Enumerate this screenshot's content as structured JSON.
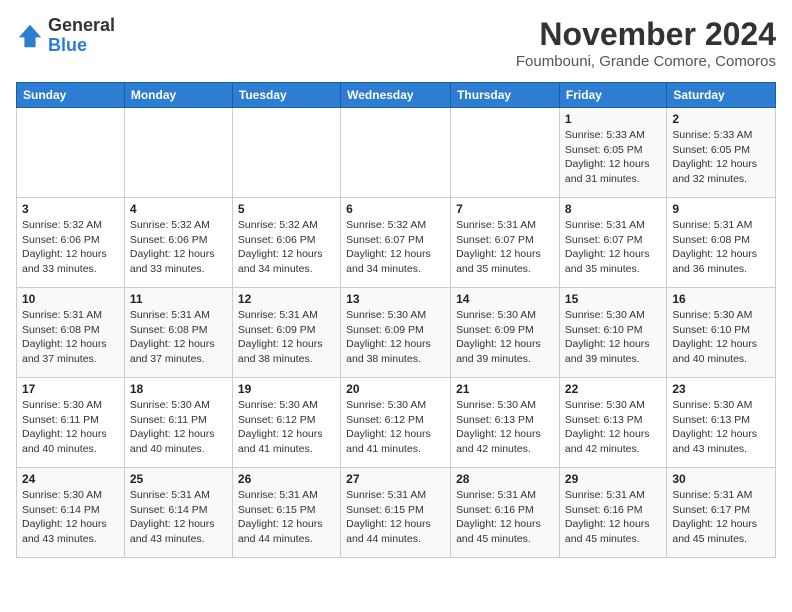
{
  "logo": {
    "general": "General",
    "blue": "Blue"
  },
  "title": "November 2024",
  "subtitle": "Foumbouni, Grande Comore, Comoros",
  "headers": [
    "Sunday",
    "Monday",
    "Tuesday",
    "Wednesday",
    "Thursday",
    "Friday",
    "Saturday"
  ],
  "weeks": [
    [
      {
        "day": "",
        "info": ""
      },
      {
        "day": "",
        "info": ""
      },
      {
        "day": "",
        "info": ""
      },
      {
        "day": "",
        "info": ""
      },
      {
        "day": "",
        "info": ""
      },
      {
        "day": "1",
        "info": "Sunrise: 5:33 AM\nSunset: 6:05 PM\nDaylight: 12 hours and 31 minutes."
      },
      {
        "day": "2",
        "info": "Sunrise: 5:33 AM\nSunset: 6:05 PM\nDaylight: 12 hours and 32 minutes."
      }
    ],
    [
      {
        "day": "3",
        "info": "Sunrise: 5:32 AM\nSunset: 6:06 PM\nDaylight: 12 hours and 33 minutes."
      },
      {
        "day": "4",
        "info": "Sunrise: 5:32 AM\nSunset: 6:06 PM\nDaylight: 12 hours and 33 minutes."
      },
      {
        "day": "5",
        "info": "Sunrise: 5:32 AM\nSunset: 6:06 PM\nDaylight: 12 hours and 34 minutes."
      },
      {
        "day": "6",
        "info": "Sunrise: 5:32 AM\nSunset: 6:07 PM\nDaylight: 12 hours and 34 minutes."
      },
      {
        "day": "7",
        "info": "Sunrise: 5:31 AM\nSunset: 6:07 PM\nDaylight: 12 hours and 35 minutes."
      },
      {
        "day": "8",
        "info": "Sunrise: 5:31 AM\nSunset: 6:07 PM\nDaylight: 12 hours and 35 minutes."
      },
      {
        "day": "9",
        "info": "Sunrise: 5:31 AM\nSunset: 6:08 PM\nDaylight: 12 hours and 36 minutes."
      }
    ],
    [
      {
        "day": "10",
        "info": "Sunrise: 5:31 AM\nSunset: 6:08 PM\nDaylight: 12 hours and 37 minutes."
      },
      {
        "day": "11",
        "info": "Sunrise: 5:31 AM\nSunset: 6:08 PM\nDaylight: 12 hours and 37 minutes."
      },
      {
        "day": "12",
        "info": "Sunrise: 5:31 AM\nSunset: 6:09 PM\nDaylight: 12 hours and 38 minutes."
      },
      {
        "day": "13",
        "info": "Sunrise: 5:30 AM\nSunset: 6:09 PM\nDaylight: 12 hours and 38 minutes."
      },
      {
        "day": "14",
        "info": "Sunrise: 5:30 AM\nSunset: 6:09 PM\nDaylight: 12 hours and 39 minutes."
      },
      {
        "day": "15",
        "info": "Sunrise: 5:30 AM\nSunset: 6:10 PM\nDaylight: 12 hours and 39 minutes."
      },
      {
        "day": "16",
        "info": "Sunrise: 5:30 AM\nSunset: 6:10 PM\nDaylight: 12 hours and 40 minutes."
      }
    ],
    [
      {
        "day": "17",
        "info": "Sunrise: 5:30 AM\nSunset: 6:11 PM\nDaylight: 12 hours and 40 minutes."
      },
      {
        "day": "18",
        "info": "Sunrise: 5:30 AM\nSunset: 6:11 PM\nDaylight: 12 hours and 40 minutes."
      },
      {
        "day": "19",
        "info": "Sunrise: 5:30 AM\nSunset: 6:12 PM\nDaylight: 12 hours and 41 minutes."
      },
      {
        "day": "20",
        "info": "Sunrise: 5:30 AM\nSunset: 6:12 PM\nDaylight: 12 hours and 41 minutes."
      },
      {
        "day": "21",
        "info": "Sunrise: 5:30 AM\nSunset: 6:13 PM\nDaylight: 12 hours and 42 minutes."
      },
      {
        "day": "22",
        "info": "Sunrise: 5:30 AM\nSunset: 6:13 PM\nDaylight: 12 hours and 42 minutes."
      },
      {
        "day": "23",
        "info": "Sunrise: 5:30 AM\nSunset: 6:13 PM\nDaylight: 12 hours and 43 minutes."
      }
    ],
    [
      {
        "day": "24",
        "info": "Sunrise: 5:30 AM\nSunset: 6:14 PM\nDaylight: 12 hours and 43 minutes."
      },
      {
        "day": "25",
        "info": "Sunrise: 5:31 AM\nSunset: 6:14 PM\nDaylight: 12 hours and 43 minutes."
      },
      {
        "day": "26",
        "info": "Sunrise: 5:31 AM\nSunset: 6:15 PM\nDaylight: 12 hours and 44 minutes."
      },
      {
        "day": "27",
        "info": "Sunrise: 5:31 AM\nSunset: 6:15 PM\nDaylight: 12 hours and 44 minutes."
      },
      {
        "day": "28",
        "info": "Sunrise: 5:31 AM\nSunset: 6:16 PM\nDaylight: 12 hours and 45 minutes."
      },
      {
        "day": "29",
        "info": "Sunrise: 5:31 AM\nSunset: 6:16 PM\nDaylight: 12 hours and 45 minutes."
      },
      {
        "day": "30",
        "info": "Sunrise: 5:31 AM\nSunset: 6:17 PM\nDaylight: 12 hours and 45 minutes."
      }
    ]
  ]
}
